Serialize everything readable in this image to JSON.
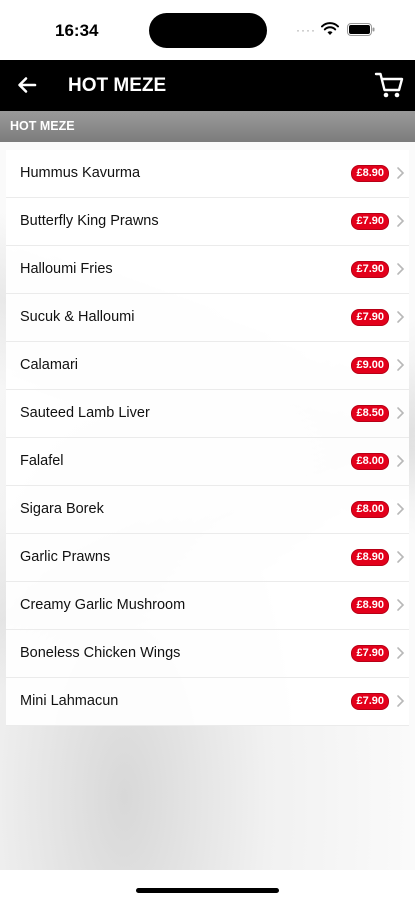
{
  "status": {
    "time": "16:34",
    "signal": "····"
  },
  "nav": {
    "title": "HOT MEZE"
  },
  "section": {
    "title": "HOT MEZE"
  },
  "items": [
    {
      "name": "Hummus Kavurma",
      "price": "£8.90"
    },
    {
      "name": "Butterfly King Prawns",
      "price": "£7.90"
    },
    {
      "name": "Halloumi Fries",
      "price": "£7.90"
    },
    {
      "name": "Sucuk & Halloumi",
      "price": "£7.90"
    },
    {
      "name": "Calamari",
      "price": "£9.00"
    },
    {
      "name": "Sauteed Lamb Liver",
      "price": "£8.50"
    },
    {
      "name": "Falafel",
      "price": "£8.00"
    },
    {
      "name": "Sigara Borek",
      "price": "£8.00"
    },
    {
      "name": "Garlic Prawns",
      "price": "£8.90"
    },
    {
      "name": "Creamy Garlic Mushroom",
      "price": "£8.90"
    },
    {
      "name": "Boneless Chicken Wings",
      "price": "£7.90"
    },
    {
      "name": "Mini Lahmacun",
      "price": "£7.90"
    }
  ],
  "colors": {
    "price_badge": "#e3001b",
    "nav_background": "#000000",
    "section_header": "#8a8a8a"
  },
  "icons": {
    "back": "arrow-left-icon",
    "cart": "cart-icon",
    "chevron": "chevron-right-icon"
  }
}
